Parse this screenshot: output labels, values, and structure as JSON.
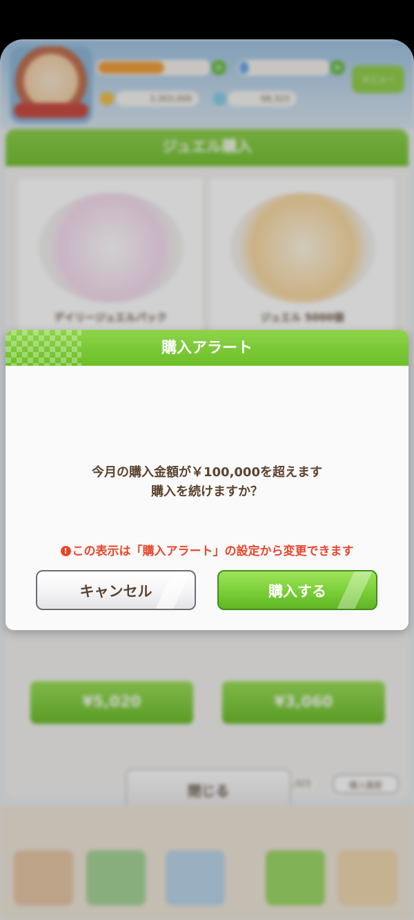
{
  "background": {
    "hud": {
      "coin_value": "3,303,000",
      "jewel_value": "68,323",
      "menu_label": "メニュー"
    },
    "panel_title": "ジュエル購入",
    "cards": [
      {
        "title": "デイリージュエルパック",
        "price": "¥5,020"
      },
      {
        "title": "ジュエル 5000個",
        "price": "¥3,060"
      }
    ],
    "jewel_total": "68,323",
    "history_button": "購入履歴",
    "close_button": "閉じる"
  },
  "modal": {
    "title": "購入アラート",
    "message_line1": "今月の購入金額が￥100,000を超えます",
    "message_line2": "購入を続けますか？",
    "warning": "この表示は「購入アラート」の設定から変更できます",
    "cancel_label": "キャンセル",
    "confirm_label": "購入する"
  },
  "colors": {
    "accent_green": "#7cc93a",
    "warning_red": "#e8452a",
    "text_brown": "#5c4330"
  }
}
